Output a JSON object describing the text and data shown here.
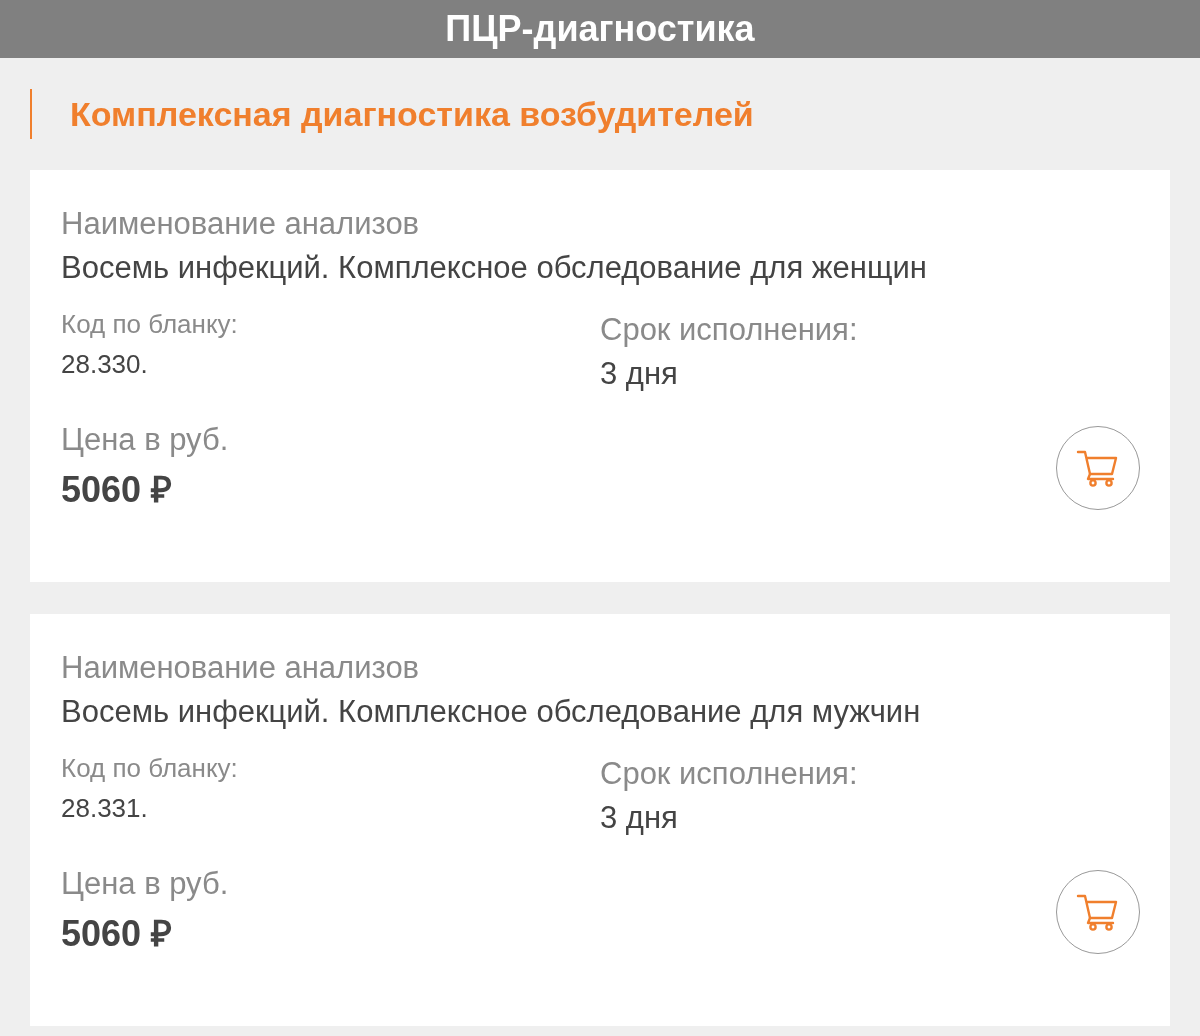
{
  "header": {
    "title": "ПЦР-диагностика"
  },
  "section": {
    "title": "Комплексная диагностика возбудителей"
  },
  "items": [
    {
      "name_label": "Наименование анализов",
      "name": "Восемь инфекций. Комплексное обследование для женщин",
      "code_label": "Код по бланку:",
      "code": "28.330.",
      "term_label": "Срок исполнения:",
      "term": "3 дня",
      "price_label": "Цена в руб.",
      "price": "5060 ₽"
    },
    {
      "name_label": "Наименование анализов",
      "name": "Восемь инфекций. Комплексное обследование для мужчин",
      "code_label": "Код по бланку:",
      "code": "28.331.",
      "term_label": "Срок исполнения:",
      "term": "3 дня",
      "price_label": "Цена в руб.",
      "price": "5060 ₽"
    }
  ]
}
